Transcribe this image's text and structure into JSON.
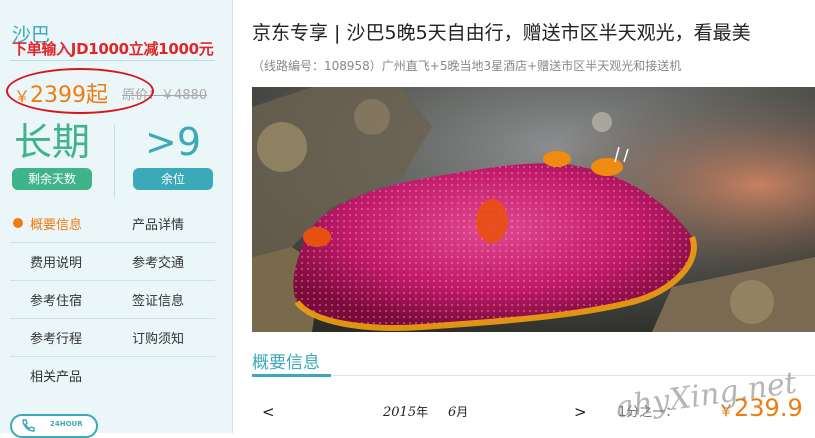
{
  "sidebar": {
    "destination": "沙巴",
    "promo": "下单输入JD1000立减1000元",
    "price_currency": "￥",
    "price_value": "2399起",
    "original_price": "原价：￥4880",
    "stats": [
      {
        "value": "长期",
        "label": "剩余天数"
      },
      {
        "value": ">9",
        "label": "余位"
      }
    ],
    "nav": [
      [
        "概要信息",
        "产品详情"
      ],
      [
        "费用说明",
        "参考交通"
      ],
      [
        "参考住宿",
        "签证信息"
      ],
      [
        "参考行程",
        "订购须知"
      ],
      [
        "相关产品",
        ""
      ]
    ],
    "phone_badge": "24HOUR"
  },
  "main": {
    "title": "京东专享 | 沙巴5晚5天自由行，赠送市区半天观光，看最美",
    "subtitle": "（线路编号：108958）广州直飞+5晚当地3星酒店+赠送市区半天观光和接送机",
    "section_title": "概要信息",
    "calendar": {
      "prev": "<",
      "year": "2015",
      "year_unit": "年",
      "month": "6",
      "month_unit": "月",
      "next": ">"
    },
    "per_person": "1分之一：",
    "bottom_price_currency": "￥",
    "bottom_price": "239.9",
    "watermark": "ahyXing.net"
  },
  "colors": {
    "accent": "#3aaab8",
    "price": "#f07c10",
    "green": "#3fb38a",
    "promo": "#e0262a"
  }
}
